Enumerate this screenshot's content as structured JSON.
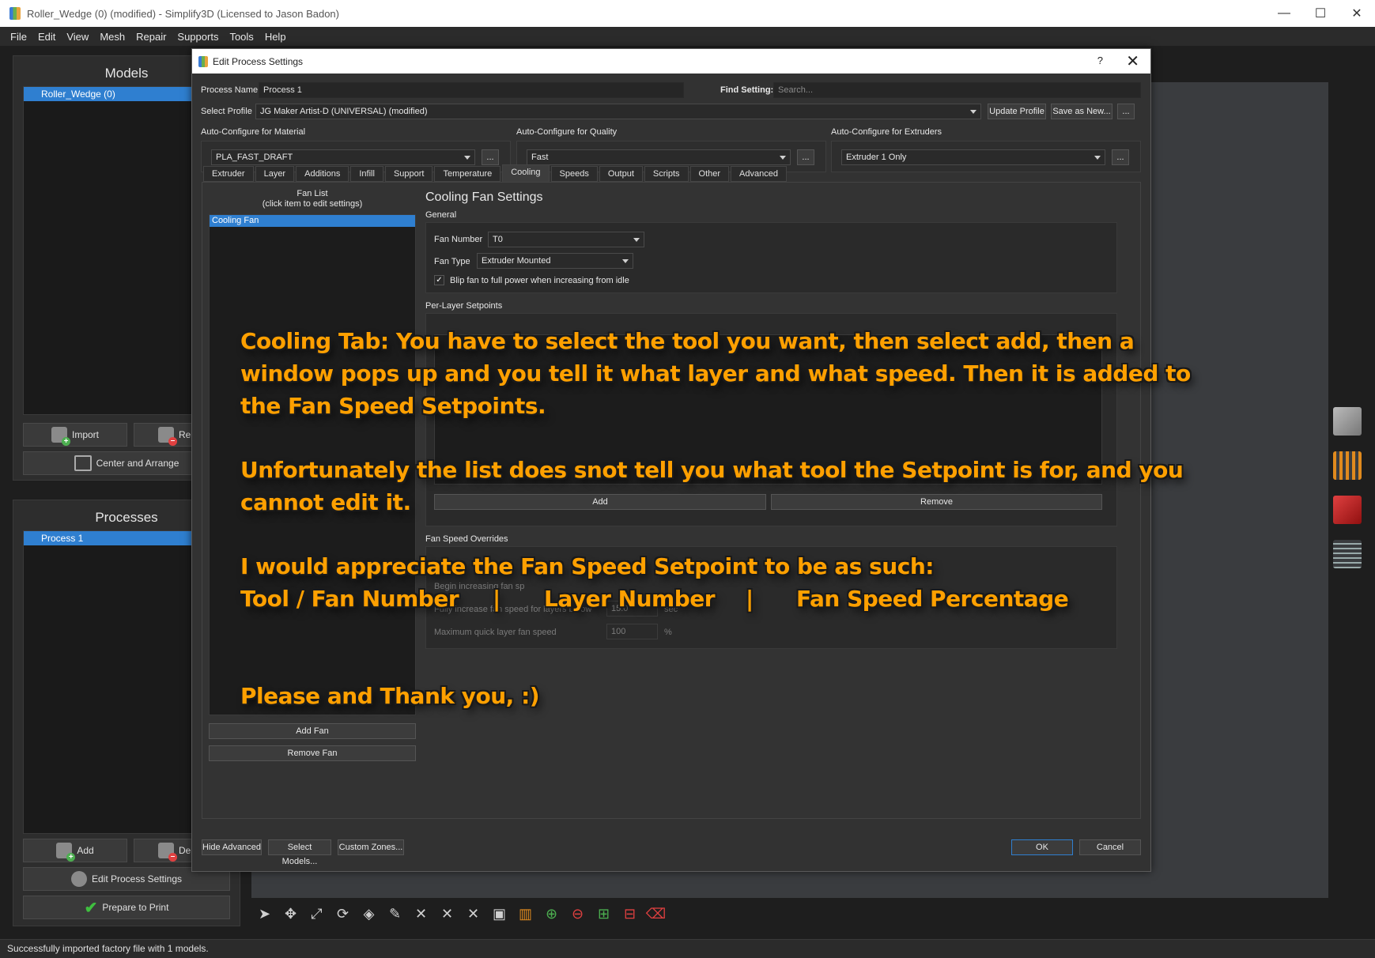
{
  "window": {
    "title": "Roller_Wedge (0) (modified) - Simplify3D (Licensed to Jason Badon)",
    "controls": [
      "—",
      "☐",
      "✕"
    ]
  },
  "menu": [
    "File",
    "Edit",
    "View",
    "Mesh",
    "Repair",
    "Supports",
    "Tools",
    "Help"
  ],
  "models_panel": {
    "title": "Models",
    "items": [
      "Roller_Wedge (0)"
    ],
    "import_label": "Import",
    "remove_label": "Rer",
    "center_label": "Center and Arrange"
  },
  "processes_panel": {
    "title": "Processes",
    "items": [
      "Process 1"
    ],
    "add_label": "Add",
    "delete_label": "De",
    "edit_label": "Edit Process Settings",
    "prepare_label": "Prepare to Print"
  },
  "status": "Successfully imported factory file with 1 models.",
  "dialog": {
    "title": "Edit Process Settings",
    "help": "?",
    "close": "✕",
    "process_name_label": "Process Name",
    "process_name_value": "Process 1",
    "find_setting_label": "Find Setting:",
    "find_setting_placeholder": "Search...",
    "select_profile_label": "Select Profile",
    "select_profile_value": "JG Maker Artist-D (UNIVERSAL) (modified)",
    "update_profile": "Update Profile",
    "save_as_new": "Save as New...",
    "ellipsis": "...",
    "material_label": "Auto-Configure for Material",
    "material_value": "PLA_FAST_DRAFT",
    "quality_label": "Auto-Configure for Quality",
    "quality_value": "Fast",
    "extruders_label": "Auto-Configure for Extruders",
    "extruders_value": "Extruder 1 Only",
    "tabs": [
      "Extruder",
      "Layer",
      "Additions",
      "Infill",
      "Support",
      "Temperature",
      "Cooling",
      "Speeds",
      "Output",
      "Scripts",
      "Other",
      "Advanced"
    ],
    "active_tab": "Cooling",
    "fan_list_title": "Fan List",
    "fan_list_subtitle": "(click item to edit settings)",
    "fan_list_items": [
      "Cooling Fan"
    ],
    "add_fan": "Add Fan",
    "remove_fan": "Remove Fan",
    "cooling_title": "Cooling Fan Settings",
    "general_label": "General",
    "fan_number_label": "Fan Number",
    "fan_number_value": "T0",
    "fan_type_label": "Fan Type",
    "fan_type_value": "Extruder Mounted",
    "blip_label": "Blip fan to full power when increasing from idle",
    "blip_checked": true,
    "per_layer_label": "Per-Layer Setpoints",
    "add_setpoint": "Add",
    "remove_setpoint": "Remove",
    "overrides_label": "Fan Speed Overrides",
    "begin_inc_label": "Begin increasing fan sp",
    "fully_inc_label": "Fully increase fan speed for layers below",
    "fully_inc_value": "15.0",
    "fully_inc_unit": "sec",
    "max_quick_label": "Maximum quick layer fan speed",
    "max_quick_value": "100",
    "max_quick_unit": "%",
    "hide_advanced": "Hide Advanced",
    "select_models": "Select Models...",
    "custom_zones": "Custom Zones...",
    "ok": "OK",
    "cancel": "Cancel"
  },
  "annotation": {
    "line1": "Cooling Tab: You have to select the tool you want, then select add, then a",
    "line2": "window pops up and you tell it what layer and what speed. Then it is added to",
    "line3": "the Fan Speed Setpoints.",
    "line4": "Unfortunately the list does snot tell you what tool the Setpoint is for, and you",
    "line5": "cannot edit it.",
    "line6": "I would appreciate the Fan Speed Setpoint to be as such:",
    "line7_a": "Tool / Fan Number",
    "line7_b": "|",
    "line7_c": "Layer Number",
    "line7_d": "|",
    "line7_e": "Fan Speed Percentage",
    "line8": "Please and Thank you, :)"
  },
  "colors": {
    "accent_blue": "#2f7fd0",
    "annotation_orange": "#ffa000"
  }
}
